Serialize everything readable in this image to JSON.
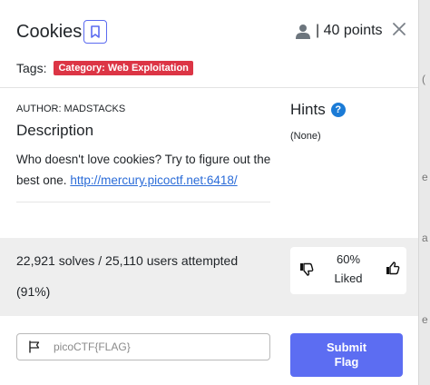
{
  "challenge": {
    "title": "Cookies",
    "points_label": "| 40 points",
    "tags_label": "Tags:",
    "tag": "Category: Web Exploitation",
    "author": "AUTHOR: MADSTACKS",
    "description_title": "Description",
    "description_text": "Who doesn't love cookies? Try to figure out the best one.",
    "description_link": "http://mercury.picoctf.net:6418/"
  },
  "hints": {
    "title": "Hints",
    "value": "(None)"
  },
  "stats": {
    "solves": "22,921 solves / 25,110 users attempted",
    "percent": "(91%)",
    "liked_percent": "60%",
    "liked_label": "Liked"
  },
  "flag": {
    "placeholder": "picoCTF{FLAG}",
    "submit_line1": "Submit",
    "submit_line2": "Flag"
  },
  "background_fragments": [
    "(",
    "e",
    "a",
    "e"
  ],
  "colors": {
    "accent": "#5c6df2",
    "tag_red": "#dc3545",
    "link": "#2b6cd8",
    "help_blue": "#1b7bd6"
  }
}
